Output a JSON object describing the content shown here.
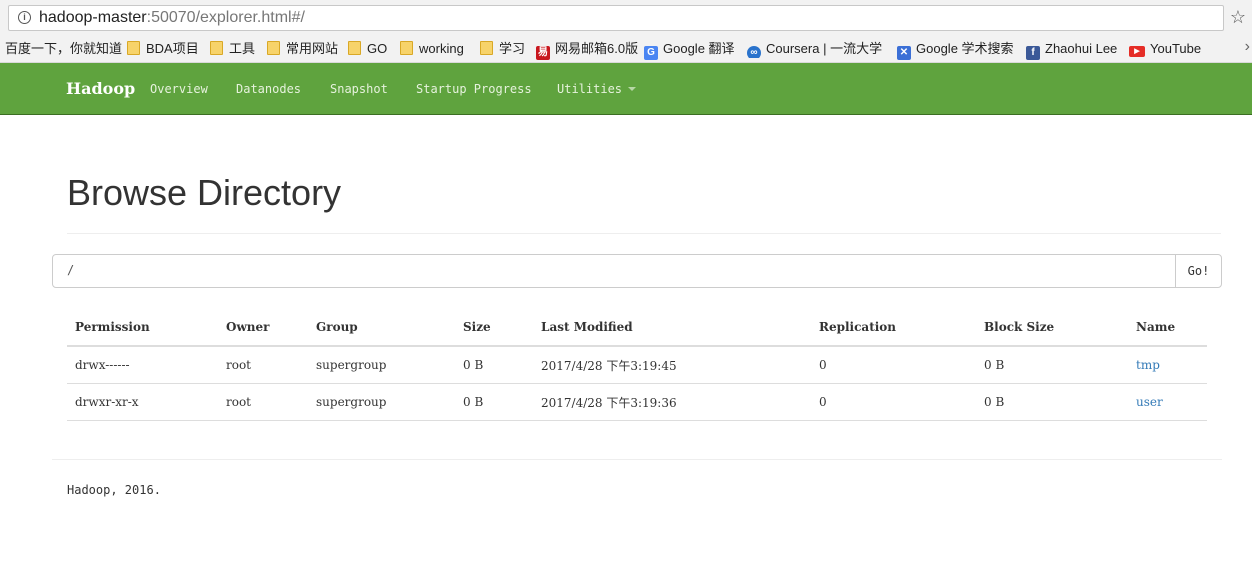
{
  "browser": {
    "url_host": "hadoop-master",
    "url_rest": ":50070/explorer.html#/"
  },
  "bookmarks": [
    {
      "label": "百度一下，你就知道",
      "icon": "none"
    },
    {
      "label": "BDA项目",
      "icon": "folder-icon"
    },
    {
      "label": "工具",
      "icon": "folder-icon"
    },
    {
      "label": "常用网站",
      "icon": "folder-icon"
    },
    {
      "label": "GO",
      "icon": "folder-icon"
    },
    {
      "label": "working",
      "icon": "folder-icon"
    },
    {
      "label": "学习",
      "icon": "folder-icon"
    },
    {
      "label": "网易邮箱6.0版",
      "icon": "netease-mail-icon"
    },
    {
      "label": "Google 翻译",
      "icon": "google-translate-icon"
    },
    {
      "label": "Coursera | 一流大学",
      "icon": "coursera-icon"
    },
    {
      "label": "Google 学术搜索",
      "icon": "google-scholar-icon"
    },
    {
      "label": "Zhaohui Lee",
      "icon": "facebook-icon"
    },
    {
      "label": "YouTube",
      "icon": "youtube-icon"
    }
  ],
  "navbar": {
    "brand": "Hadoop",
    "items": [
      "Overview",
      "Datanodes",
      "Snapshot",
      "Startup Progress",
      "Utilities"
    ]
  },
  "page": {
    "title": "Browse Directory",
    "path_value": "/",
    "go_label": "Go!"
  },
  "table": {
    "headers": [
      "Permission",
      "Owner",
      "Group",
      "Size",
      "Last Modified",
      "Replication",
      "Block Size",
      "Name"
    ],
    "rows": [
      [
        "drwx------",
        "root",
        "supergroup",
        "0 B",
        "2017/4/28 下午3:19:45",
        "0",
        "0 B",
        "tmp"
      ],
      [
        "drwxr-xr-x",
        "root",
        "supergroup",
        "0 B",
        "2017/4/28 下午3:19:36",
        "0",
        "0 B",
        "user"
      ]
    ]
  },
  "footer": {
    "text": "Hadoop, 2016."
  },
  "colors": {
    "navbar": "#5fa33e",
    "link": "#337ab7"
  }
}
